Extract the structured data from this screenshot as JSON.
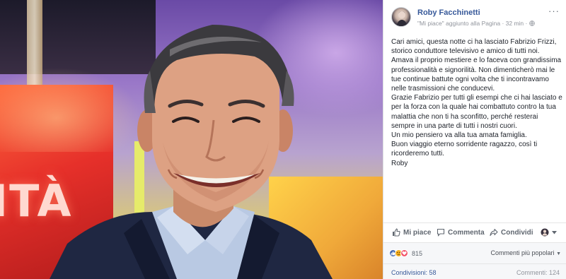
{
  "post": {
    "author": "Roby Facchinetti",
    "subline": "\"Mi piace\" aggiunto alla Pagina · 32 min · ",
    "globe_icon": "globe-icon",
    "more_label": "···",
    "paragraphs": [
      "Cari amici, questa notte ci ha lasciato Fabrizio Frizzi, storico conduttore televisivo e amico di tutti noi. Amava il proprio mestiere e lo faceva con grandissima professionalità e signorilità. Non dimenticherò mai le tue continue battute ogni volta che ti incontravamo nelle trasmissioni che conducevi.",
      "Grazie Fabrizio per tutti gli esempi che ci hai lasciato e per la forza con la quale hai combattuto contro la tua malattia che non ti ha sconfitto, perché resterai sempre in una parte di tutti i nostri cuori.",
      "Un mio pensiero va alla tua amata famiglia.",
      "Buon viaggio eterno sorridente ragazzo, così ti ricorderemo tutti.",
      "Roby"
    ]
  },
  "photo": {
    "sign_text": "ITÀ"
  },
  "actions": {
    "like": "Mi piace",
    "comment": "Commenta",
    "share": "Condividi"
  },
  "stats": {
    "reaction_count": "815",
    "sort_label": "Commenti più popolari",
    "shares": "Condivisioni: 58",
    "comments": "Commenti: 124"
  },
  "colors": {
    "link_blue": "#365899",
    "like_blue": "#4267b2",
    "love_red": "#f25268",
    "wow_yellow": "#f7b125"
  }
}
